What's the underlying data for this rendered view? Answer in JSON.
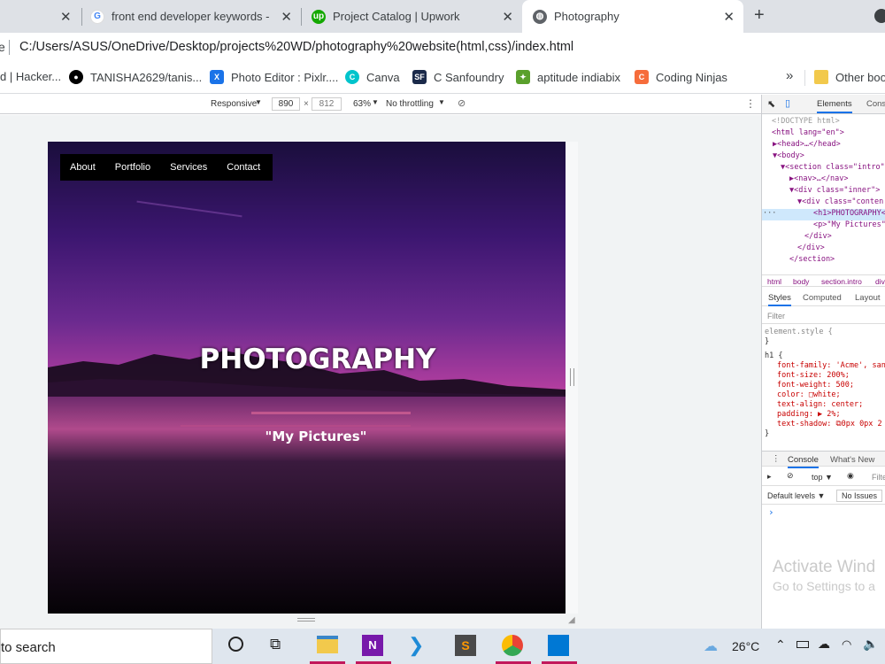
{
  "tabs": [
    {
      "title": "front end developer keywords - G"
    },
    {
      "title": "Project Catalog | Upwork"
    },
    {
      "title": "Photography"
    }
  ],
  "address": {
    "url": "C:/Users/ASUS/OneDrive/Desktop/projects%20WD/photography%20website(html,css)/index.html"
  },
  "bookmarks": [
    {
      "label": "d | Hacker..."
    },
    {
      "label": "TANISHA2629/tanis..."
    },
    {
      "label": "Photo Editor : Pixlr...."
    },
    {
      "label": "Canva"
    },
    {
      "label": "C Sanfoundry"
    },
    {
      "label": "aptitude indiabix"
    },
    {
      "label": "Coding Ninjas"
    },
    {
      "label": "»"
    },
    {
      "label": "Other boo"
    }
  ],
  "device_toolbar": {
    "mode": "Responsive",
    "width": "890",
    "x": "×",
    "height": "812",
    "zoom": "63%",
    "throttle": "No throttling"
  },
  "page": {
    "nav": [
      "About",
      "Portfolio",
      "Services",
      "Contact"
    ],
    "title": "PHOTOGRAPHY",
    "subtitle": "\"My Pictures\""
  },
  "devtools": {
    "tabs": [
      "Elements",
      "Cons"
    ],
    "dom": [
      "<!DOCTYPE html>",
      "<html lang=\"en\">",
      "▶<head>…</head>",
      "▼<body>",
      "▼<section class=\"intro\"",
      "▶<nav>…</nav>",
      "▼<div class=\"inner\">",
      "▼<div class=\"conten",
      "<h1>PHOTOGRAPHY</",
      "<p>\"My Pictures\"",
      "</div>",
      "</div>",
      "</section>"
    ],
    "breadcrumb": [
      "html",
      "body",
      "section.intro",
      "div"
    ],
    "style_tabs": [
      "Styles",
      "Computed",
      "Layout"
    ],
    "filter": "Filter",
    "rules": [
      "element.style {",
      "}",
      "h1 {",
      "font-family: 'Acme', san",
      "font-size: 200%;",
      "font-weight: 500;",
      "color: □white;",
      "text-align: center;",
      "padding: ▶ 2%;",
      "text-shadow: ⧉0px 0px 2",
      "}"
    ],
    "console_tabs": [
      "Console",
      "What's New"
    ],
    "console_top": "top ▼",
    "console_filter": "Filte",
    "levels": "Default levels ▼",
    "issues": "No Issues",
    "prompt": "›"
  },
  "watermark": {
    "line1": "Activate Wind",
    "line2": "Go to Settings to a"
  },
  "taskbar": {
    "search": "to search",
    "temp": "26°C"
  },
  "colors": {
    "accent": "#1a73e8",
    "hero_top": "#2a1458",
    "hero_glow": "#e0628c"
  }
}
